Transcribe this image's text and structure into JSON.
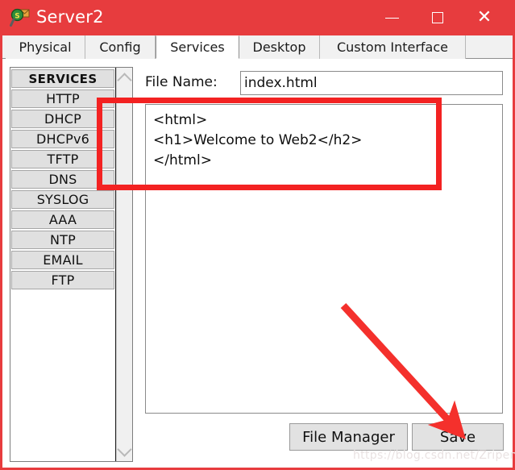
{
  "window": {
    "title": "Server2",
    "icon": "server-magnifier-icon",
    "accent_color": "#e73c3e",
    "controls": {
      "minimize": "minimize-icon",
      "maximize": "maximize-icon",
      "close": "close-icon"
    }
  },
  "tabs": [
    {
      "label": "Physical",
      "active": false
    },
    {
      "label": "Config",
      "active": false
    },
    {
      "label": "Services",
      "active": true
    },
    {
      "label": "Desktop",
      "active": false
    },
    {
      "label": "Custom Interface",
      "active": false
    }
  ],
  "sidebar": {
    "header": "SERVICES",
    "items": [
      {
        "label": "HTTP"
      },
      {
        "label": "DHCP"
      },
      {
        "label": "DHCPv6"
      },
      {
        "label": "TFTP"
      },
      {
        "label": "DNS"
      },
      {
        "label": "SYSLOG"
      },
      {
        "label": "AAA"
      },
      {
        "label": "NTP"
      },
      {
        "label": "EMAIL"
      },
      {
        "label": "FTP"
      }
    ],
    "scroll_up_icon": "chevron-up-icon",
    "scroll_down_icon": "chevron-down-icon"
  },
  "main": {
    "filename_label": "File Name:",
    "filename_value": "index.html",
    "filename_placeholder": "",
    "editor_content": "<html>\n<h1>Welcome to Web2</h2>\n</html>"
  },
  "buttons": {
    "file_manager": "File Manager",
    "save": "Save"
  },
  "annotations": {
    "highlight_color": "#f32222",
    "arrow_color": "#f4302c"
  },
  "watermark": "https://blog.csdn.net/ZripenYe"
}
